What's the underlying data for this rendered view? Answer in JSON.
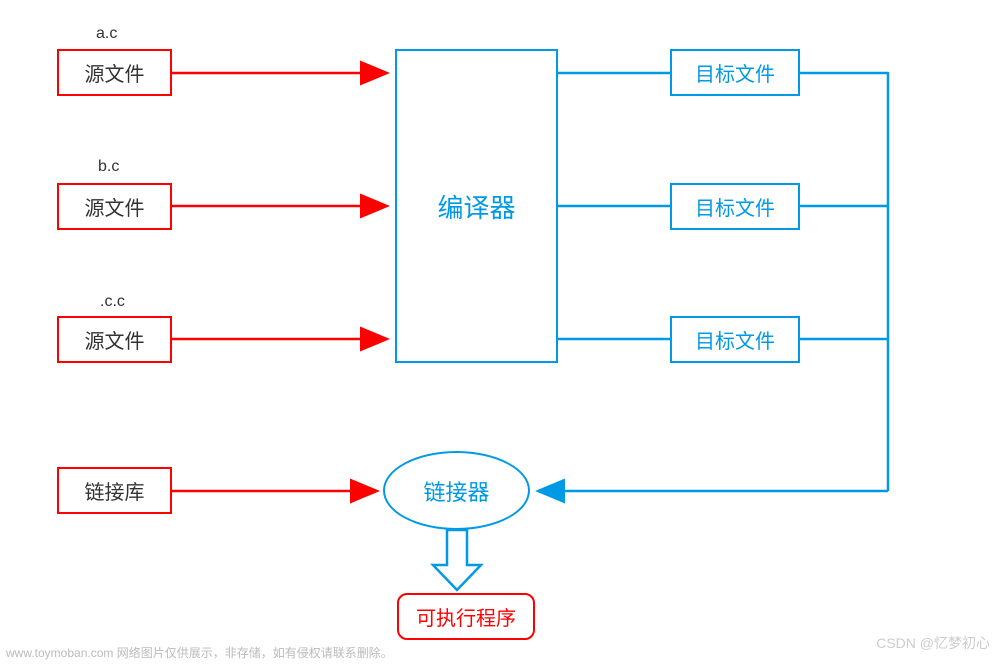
{
  "source_labels": {
    "a": "a.c",
    "b": "b.c",
    "c": ".c.c"
  },
  "boxes": {
    "source": "源文件",
    "library": "链接库",
    "compiler": "编译器",
    "target": "目标文件",
    "linker": "链接器",
    "executable": "可执行程序"
  },
  "footer_left": "www.toymoban.com 网络图片仅供展示，非存储，如有侵权请联系删除。",
  "watermark": "CSDN @忆梦初心",
  "colors": {
    "red": "#ff0000",
    "blue": "#0099e5"
  }
}
